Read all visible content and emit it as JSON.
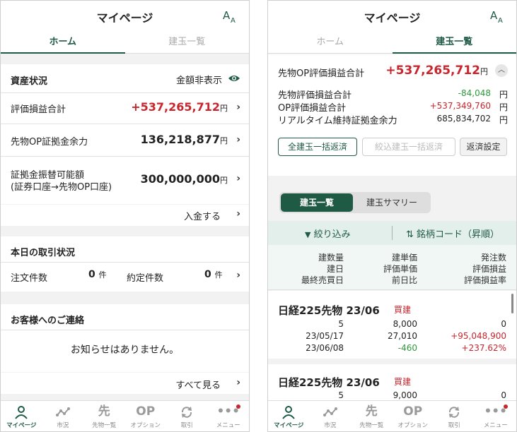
{
  "left": {
    "header_title": "マイページ",
    "tabs": [
      {
        "label": "ホーム"
      },
      {
        "label": "建玉一覧"
      }
    ],
    "asset": {
      "section_title": "資産状況",
      "hide_amount_label": "金額非表示",
      "rows": [
        {
          "label": "評価損益合計",
          "value": "+537,265,712",
          "unit": "円"
        },
        {
          "label": "先物OP証拠金余力",
          "value": "136,218,877",
          "unit": "円"
        },
        {
          "label_line1": "証拠金振替可能額",
          "label_line2": "(証券口座→先物OP口座)",
          "value": "300,000,000",
          "unit": "円"
        }
      ],
      "deposit_link": "入金する"
    },
    "today": {
      "section_title": "本日の取引状況",
      "order_label": "注文件数",
      "order_count": "0",
      "order_unit": "件",
      "exec_label": "約定件数",
      "exec_count": "0",
      "exec_unit": "件"
    },
    "notice": {
      "section_title": "お客様へのご連絡",
      "empty_message": "お知らせはありません。",
      "see_all": "すべて見る"
    }
  },
  "right": {
    "header_title": "マイページ",
    "tabs": [
      {
        "label": "ホーム"
      },
      {
        "label": "建玉一覧"
      }
    ],
    "summary": {
      "main_label": "先物OP評価損益合計",
      "main_value": "+537,265,712",
      "main_unit": "円",
      "rows": [
        {
          "label": "先物評価損益合計",
          "value": "-84,048",
          "unit": "円"
        },
        {
          "label": "OP評価損益合計",
          "value": "+537,349,760",
          "unit": "円"
        },
        {
          "label": "リアルタイム維持証拠金余力",
          "value": "685,834,702",
          "unit": "円"
        }
      ]
    },
    "buttons": {
      "close_all": "全建玉一括返済",
      "close_filtered": "絞込建玉一括返済",
      "settings": "返済設定"
    },
    "segment": {
      "list": "建玉一覧",
      "summary": "建玉サマリー"
    },
    "filter": {
      "filter_label": "絞り込み",
      "sort_label": "銘柄コード（昇順）"
    },
    "columns": {
      "col1": [
        "建数量",
        "建日",
        "最終売買日"
      ],
      "col2": [
        "建単価",
        "評価単価",
        "前日比"
      ],
      "col3": [
        "発注数",
        "評価損益",
        "評価損益率"
      ]
    },
    "positions": [
      {
        "name": "日経225先物 23/06",
        "side": "買建",
        "qty": "5",
        "price": "8,000",
        "order": "0",
        "date": "23/05/17",
        "eval_price": "27,010",
        "pl": "+95,048,900",
        "last_date": "23/06/08",
        "change": "-460",
        "pl_rate": "+237.62%"
      },
      {
        "name": "日経225先物 23/06",
        "side": "買建",
        "qty": "5",
        "price": "9,000",
        "order": "0"
      }
    ]
  },
  "nav": {
    "items": [
      {
        "label": "マイページ"
      },
      {
        "label": "市況"
      },
      {
        "label": "先物一覧",
        "glyph": "先"
      },
      {
        "label": "オプション",
        "glyph": "OP"
      },
      {
        "label": "取引"
      },
      {
        "label": "メニュー"
      }
    ]
  },
  "colors": {
    "brand_green": "#1f5a45",
    "profit_red": "#c9252d",
    "loss_green": "#2e9a3a"
  }
}
